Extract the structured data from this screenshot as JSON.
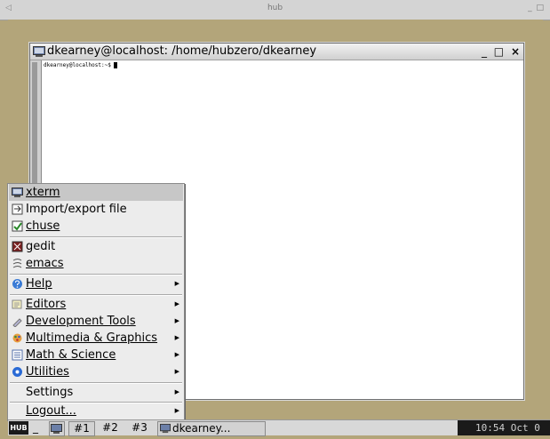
{
  "outer_window": {
    "title": "hub",
    "left_control": "◁",
    "right_controls": "_ □"
  },
  "xterm": {
    "title": "dkearney@localhost: /home/hubzero/dkearney",
    "prompt": "dkearney@localhost:~$ ",
    "buttons": {
      "minimize": "_",
      "maximize": "□",
      "close": "×"
    }
  },
  "menu": {
    "items": [
      {
        "label": "xterm",
        "icon": "terminal-icon"
      },
      {
        "label": "Import/export file",
        "icon": "import-export-icon"
      },
      {
        "label": "chuse",
        "icon": "checkbox-icon"
      },
      {
        "label": "gedit",
        "icon": "gedit-icon"
      },
      {
        "label": "emacs",
        "icon": "emacs-icon"
      },
      {
        "label": "Help",
        "icon": "help-icon"
      },
      {
        "label": "Editors",
        "icon": "editors-icon"
      },
      {
        "label": "Development Tools",
        "icon": "development-tools-icon"
      },
      {
        "label": "Multimedia & Graphics",
        "icon": "multimedia-icon"
      },
      {
        "label": "Math & Science",
        "icon": "math-science-icon"
      },
      {
        "label": "Utilities",
        "icon": "utilities-icon"
      },
      {
        "label": "Settings",
        "icon": ""
      },
      {
        "label": "Logout...",
        "icon": ""
      }
    ],
    "submenu_arrow": "▶"
  },
  "taskbar": {
    "logo": "HUB",
    "minimize_label": "_",
    "workspaces": [
      "#1",
      "#2",
      "#3"
    ],
    "task_label": "dkearney...",
    "clock": "10:54 Oct 0"
  },
  "colors": {
    "desktop": "#b3a57a",
    "menu_bg": "#ececec",
    "menu_highlight": "#c7c7c7"
  }
}
